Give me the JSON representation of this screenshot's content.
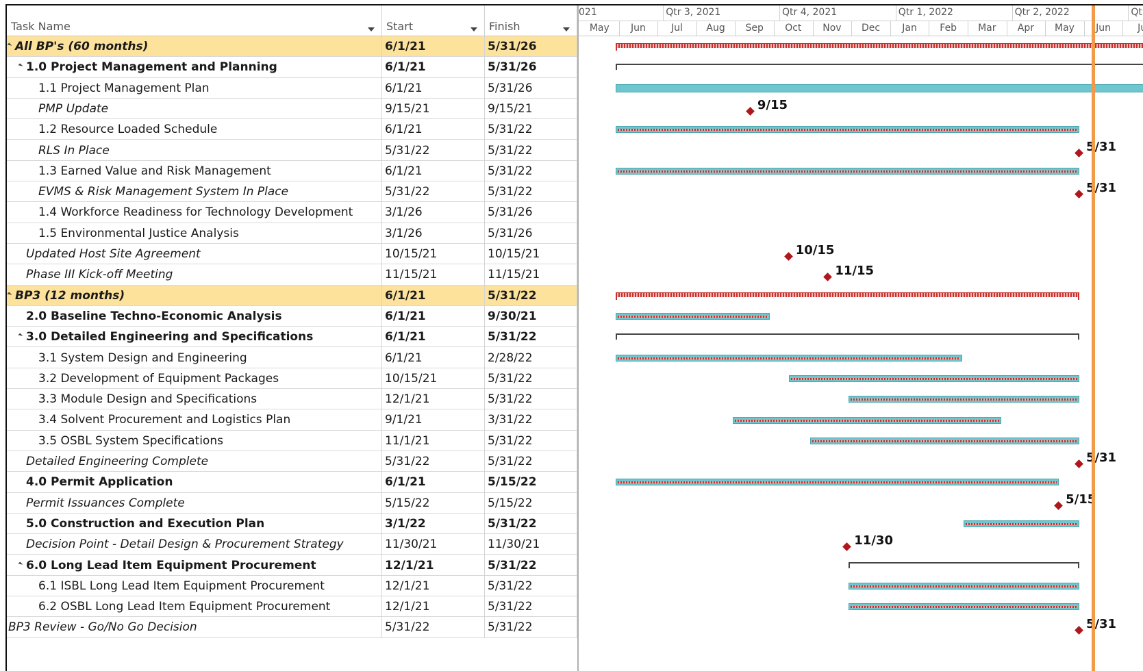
{
  "columns": {
    "name": "Task Name",
    "start": "Start",
    "finish": "Finish"
  },
  "timescale": {
    "quarters": [
      "021",
      "Qtr 3, 2021",
      "Qtr 4, 2021",
      "Qtr 1, 2022",
      "Qtr 2, 2022",
      "Qtr"
    ],
    "months": [
      "May",
      "Jun",
      "Jul",
      "Aug",
      "Sep",
      "Oct",
      "Nov",
      "Dec",
      "Jan",
      "Feb",
      "Mar",
      "Apr",
      "May",
      "Jun",
      "Ju"
    ]
  },
  "tasks": [
    {
      "name": "All BP's (60 months)",
      "start": "6/1/21",
      "finish": "5/31/26",
      "style": "summary",
      "indent": 0,
      "collapse": true
    },
    {
      "name": "1.0 Project Management and Planning",
      "start": "6/1/21",
      "finish": "5/31/26",
      "style": "bold",
      "indent": 1,
      "collapse": true
    },
    {
      "name": "1.1 Project Management Plan",
      "start": "6/1/21",
      "finish": "5/31/26",
      "style": "normal",
      "indent": 2
    },
    {
      "name": "PMP Update",
      "start": "9/15/21",
      "finish": "9/15/21",
      "style": "italic",
      "indent": 2
    },
    {
      "name": "1.2 Resource Loaded Schedule",
      "start": "6/1/21",
      "finish": "5/31/22",
      "style": "normal",
      "indent": 2
    },
    {
      "name": "RLS In Place",
      "start": "5/31/22",
      "finish": "5/31/22",
      "style": "italic",
      "indent": 2
    },
    {
      "name": "1.3 Earned Value and Risk Management",
      "start": "6/1/21",
      "finish": "5/31/22",
      "style": "normal",
      "indent": 2
    },
    {
      "name": "EVMS & Risk Management System In Place",
      "start": "5/31/22",
      "finish": "5/31/22",
      "style": "italic",
      "indent": 2
    },
    {
      "name": "1.4 Workforce Readiness for Technology Development",
      "start": "3/1/26",
      "finish": "5/31/26",
      "style": "normal",
      "indent": 2
    },
    {
      "name": "1.5 Environmental Justice Analysis",
      "start": "3/1/26",
      "finish": "5/31/26",
      "style": "normal",
      "indent": 2
    },
    {
      "name": "Updated Host Site Agreement",
      "start": "10/15/21",
      "finish": "10/15/21",
      "style": "italic",
      "indent": 1
    },
    {
      "name": "Phase III Kick-off Meeting",
      "start": "11/15/21",
      "finish": "11/15/21",
      "style": "italic",
      "indent": 1
    },
    {
      "name": "BP3 (12 months)",
      "start": "6/1/21",
      "finish": "5/31/22",
      "style": "summary",
      "indent": 0,
      "collapse": true
    },
    {
      "name": "2.0 Baseline Techno-Economic Analysis",
      "start": "6/1/21",
      "finish": "9/30/21",
      "style": "bold",
      "indent": 1
    },
    {
      "name": "3.0 Detailed Engineering and Specifications",
      "start": "6/1/21",
      "finish": "5/31/22",
      "style": "bold",
      "indent": 1,
      "collapse": true
    },
    {
      "name": "3.1 System Design and Engineering",
      "start": "6/1/21",
      "finish": "2/28/22",
      "style": "normal",
      "indent": 2
    },
    {
      "name": "3.2 Development of Equipment Packages",
      "start": "10/15/21",
      "finish": "5/31/22",
      "style": "normal",
      "indent": 2
    },
    {
      "name": "3.3 Module Design and Specifications",
      "start": "12/1/21",
      "finish": "5/31/22",
      "style": "normal",
      "indent": 2
    },
    {
      "name": "3.4 Solvent Procurement and Logistics Plan",
      "start": "9/1/21",
      "finish": "3/31/22",
      "style": "normal",
      "indent": 2
    },
    {
      "name": "3.5 OSBL System Specifications",
      "start": "11/1/21",
      "finish": "5/31/22",
      "style": "normal",
      "indent": 2
    },
    {
      "name": "Detailed Engineering Complete",
      "start": "5/31/22",
      "finish": "5/31/22",
      "style": "italic",
      "indent": 1
    },
    {
      "name": "4.0 Permit Application",
      "start": "6/1/21",
      "finish": "5/15/22",
      "style": "bold",
      "indent": 1
    },
    {
      "name": "Permit Issuances Complete",
      "start": "5/15/22",
      "finish": "5/15/22",
      "style": "italic",
      "indent": 1
    },
    {
      "name": "5.0 Construction and Execution Plan",
      "start": "3/1/22",
      "finish": "5/31/22",
      "style": "bold",
      "indent": 1
    },
    {
      "name": "Decision Point - Detail Design & Procurement Strategy",
      "start": "11/30/21",
      "finish": "11/30/21",
      "style": "italic",
      "indent": 1
    },
    {
      "name": "6.0 Long Lead Item Equipment Procurement",
      "start": "12/1/21",
      "finish": "5/31/22",
      "style": "bold",
      "indent": 1,
      "collapse": true
    },
    {
      "name": "6.1 ISBL Long Lead Item Equipment Procurement",
      "start": "12/1/21",
      "finish": "5/31/22",
      "style": "normal",
      "indent": 2
    },
    {
      "name": "6.2 OSBL Long Lead Item Equipment Procurement",
      "start": "12/1/21",
      "finish": "5/31/22",
      "style": "normal",
      "indent": 2
    },
    {
      "name": "BP3 Review - Go/No Go Decision",
      "start": "5/31/22",
      "finish": "5/31/22",
      "style": "italic",
      "indent": 0
    }
  ],
  "gantt": [
    {
      "kind": "summary",
      "from": "2021-06-01",
      "to": "open"
    },
    {
      "kind": "bracket",
      "from": "2021-06-01",
      "to": "open"
    },
    {
      "kind": "bar",
      "from": "2021-06-01",
      "to": "open",
      "plain": true
    },
    {
      "kind": "milestone",
      "at": "2021-09-15",
      "label": "9/15"
    },
    {
      "kind": "bar",
      "from": "2021-06-01",
      "to": "2022-05-31"
    },
    {
      "kind": "milestone",
      "at": "2022-05-31",
      "label": "5/31"
    },
    {
      "kind": "bar",
      "from": "2021-06-01",
      "to": "2022-05-31"
    },
    {
      "kind": "milestone",
      "at": "2022-05-31",
      "label": "5/31"
    },
    {
      "kind": "none"
    },
    {
      "kind": "none"
    },
    {
      "kind": "milestone",
      "at": "2021-10-15",
      "label": "10/15"
    },
    {
      "kind": "milestone",
      "at": "2021-11-15",
      "label": "11/15"
    },
    {
      "kind": "summary",
      "from": "2021-06-01",
      "to": "2022-05-31"
    },
    {
      "kind": "bar",
      "from": "2021-06-01",
      "to": "2021-09-30"
    },
    {
      "kind": "bracket",
      "from": "2021-06-01",
      "to": "2022-05-31"
    },
    {
      "kind": "bar",
      "from": "2021-06-01",
      "to": "2022-02-28"
    },
    {
      "kind": "bar",
      "from": "2021-10-15",
      "to": "2022-05-31"
    },
    {
      "kind": "bar",
      "from": "2021-12-01",
      "to": "2022-05-31"
    },
    {
      "kind": "bar",
      "from": "2021-09-01",
      "to": "2022-03-31"
    },
    {
      "kind": "bar",
      "from": "2021-11-01",
      "to": "2022-05-31"
    },
    {
      "kind": "milestone",
      "at": "2022-05-31",
      "label": "5/31"
    },
    {
      "kind": "bar",
      "from": "2021-06-01",
      "to": "2022-05-15"
    },
    {
      "kind": "milestone",
      "at": "2022-05-15",
      "label": "5/15"
    },
    {
      "kind": "bar",
      "from": "2022-03-01",
      "to": "2022-05-31"
    },
    {
      "kind": "milestone",
      "at": "2021-11-30",
      "label": "11/30"
    },
    {
      "kind": "bracket",
      "from": "2021-12-01",
      "to": "2022-05-31"
    },
    {
      "kind": "bar",
      "from": "2021-12-01",
      "to": "2022-05-31"
    },
    {
      "kind": "bar",
      "from": "2021-12-01",
      "to": "2022-05-31"
    },
    {
      "kind": "milestone",
      "at": "2022-05-31",
      "label": "5/31"
    }
  ],
  "colors": {
    "summary_row": "#fde29c",
    "task_bar": "#6ec6cf",
    "critical": "#c9302c",
    "milestone": "#b0171d",
    "today_line": "#f2994a"
  }
}
